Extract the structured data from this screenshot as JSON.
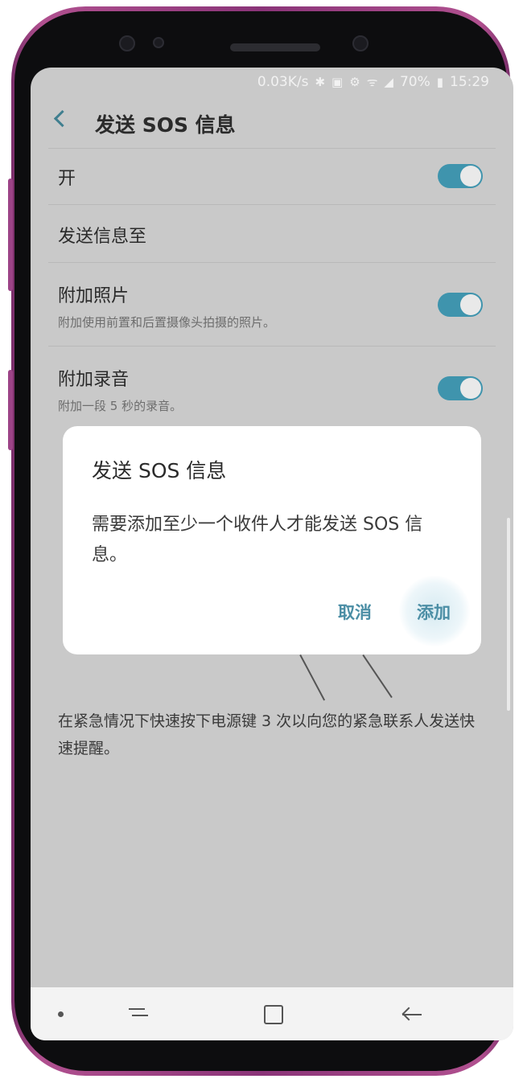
{
  "status_bar": {
    "speed": "0.03K/s",
    "battery": "70%",
    "time": "15:29",
    "icons": [
      "bluetooth-icon",
      "nfc-icon",
      "sync-icon",
      "wifi-icon",
      "signal-icon",
      "battery-icon"
    ]
  },
  "header": {
    "title": "发送 SOS 信息"
  },
  "settings": {
    "on_label": "开",
    "send_to_label": "发送信息至",
    "attach_photo": {
      "title": "附加照片",
      "subtitle": "附加使用前置和后置摄像头拍摄的照片。"
    },
    "attach_audio": {
      "title": "附加录音",
      "subtitle": "附加一段 5 秒的录音。"
    },
    "footer_description": "在紧急情况下快速按下电源键 3 次以向您的紧急联系人发送快速提醒。"
  },
  "dialog": {
    "title": "发送 SOS 信息",
    "message": "需要添加至少一个收件人才能发送 SOS 信息。",
    "cancel_label": "取消",
    "add_label": "添加"
  },
  "colors": {
    "accent": "#3f94ad",
    "dim_background": "#c9c9c9",
    "phone_frame": "#8a3478"
  }
}
